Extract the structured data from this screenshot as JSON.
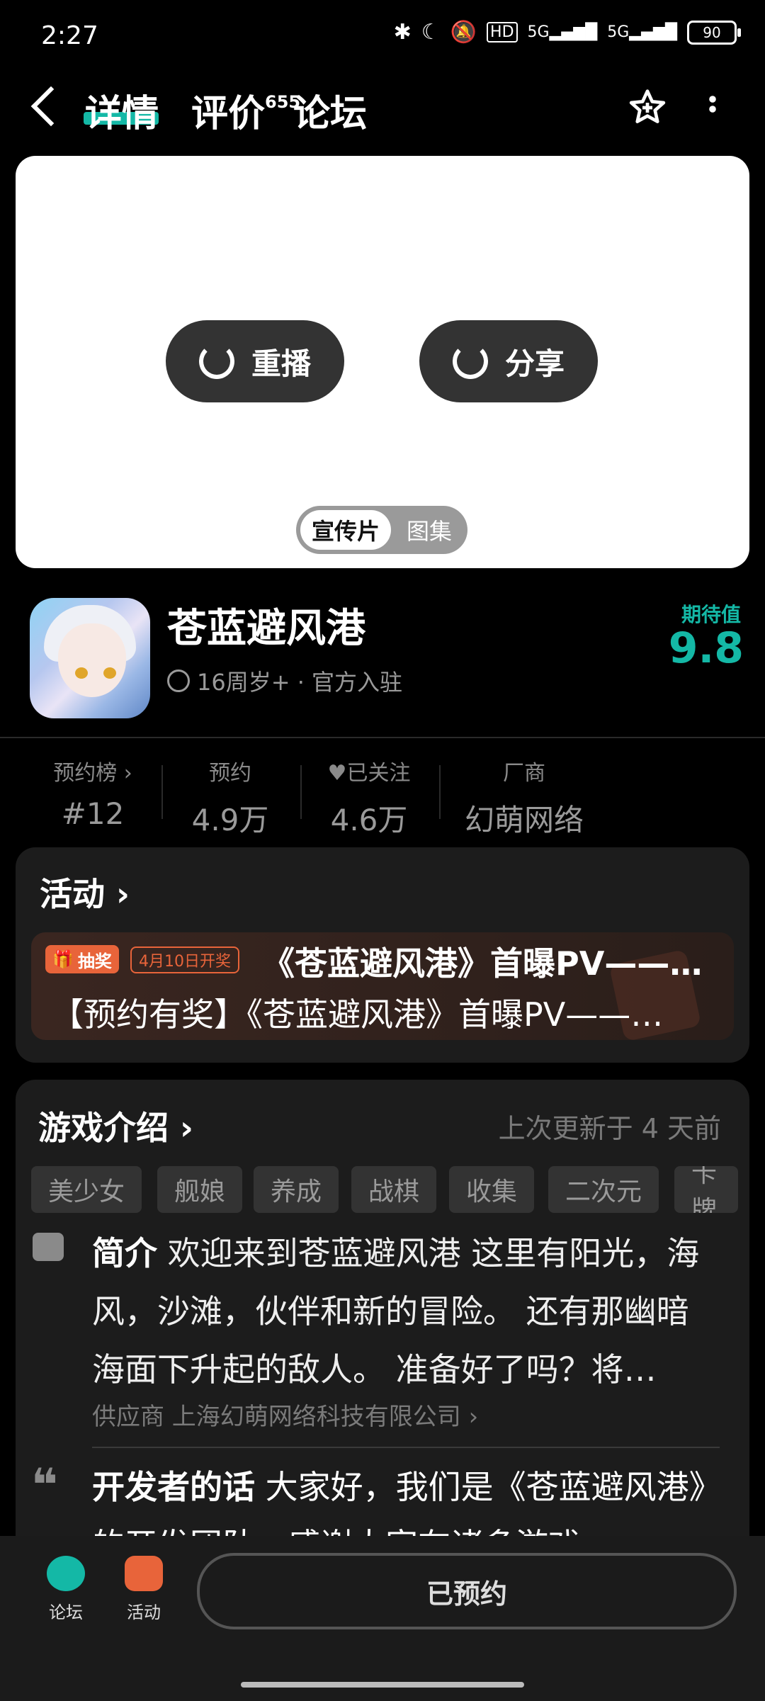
{
  "status_bar": {
    "time": "2:27",
    "icons": [
      "bluetooth-icon",
      "moon-icon",
      "mute-icon",
      "hd-icon",
      "signal-5g-icon",
      "signal-5g-icon"
    ],
    "battery": "90"
  },
  "header": {
    "tabs": [
      {
        "label": "详情",
        "active": true
      },
      {
        "label": "评价",
        "count": "655"
      },
      {
        "label": "论坛"
      }
    ]
  },
  "player": {
    "replay_label": "重播",
    "share_label": "分享",
    "segment": [
      "宣传片",
      "图集"
    ]
  },
  "game": {
    "name": "苍蓝避风港",
    "meta": "16周岁+ · 官方入驻",
    "expect_label": "期待值",
    "expect_value": "9.8"
  },
  "stats": [
    {
      "label": "预约榜 ›",
      "value": "#12"
    },
    {
      "label": "预约",
      "value": "4.9万"
    },
    {
      "label": "已关注",
      "value": "4.6万"
    },
    {
      "label": "厂商",
      "value": "幻萌网络"
    }
  ],
  "activity": {
    "title": "活动 ›",
    "badge": "抽奖",
    "date_badge": "4月10日开奖",
    "event_title": "《苍蓝避风港》首曝PV——…",
    "event_sub": "【预约有奖】《苍蓝避风港》首曝PV——…"
  },
  "intro": {
    "title": "游戏介绍 ›",
    "updated": "上次更新于 4 天前",
    "tags": [
      "美少女",
      "舰娘",
      "养成",
      "战棋",
      "收集",
      "二次元",
      "卡牌"
    ],
    "summary_label": "简介",
    "summary_text": "欢迎来到苍蓝避风港 这里有阳光，海风，沙滩，伙伴和新的冒险。 还有那幽暗海面下升起的敌人。 准备好了吗？将…",
    "supplier": "供应商 上海幻萌网络科技有限公司 ›",
    "dev_label": "开发者的话",
    "dev_text": "大家好，我们是《苍蓝避风港》的开发团队，感谢大家在诸多游戏"
  },
  "bottom_bar": {
    "forum_label": "论坛",
    "activity_label": "活动",
    "reserve_label": "已预约"
  },
  "colors": {
    "accent": "#14b8a6",
    "activity": "#e8643a"
  }
}
